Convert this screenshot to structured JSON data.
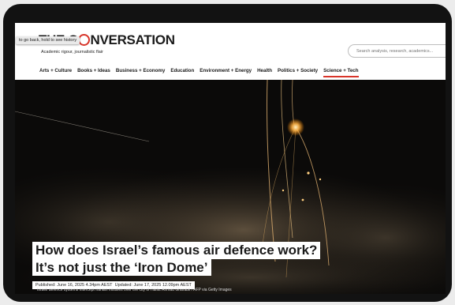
{
  "browser": {
    "back_tooltip": "to go back, hold to see history"
  },
  "site": {
    "logo_prefix": "THE C",
    "logo_suffix": "NVERSATION",
    "tagline": "Academic rigour, journalistic flair"
  },
  "search": {
    "placeholder": "Search analysis, research, academics..."
  },
  "nav": {
    "items": [
      {
        "label": "Arts + Culture"
      },
      {
        "label": "Books + Ideas"
      },
      {
        "label": "Business + Economy"
      },
      {
        "label": "Education"
      },
      {
        "label": "Environment + Energy"
      },
      {
        "label": "Health"
      },
      {
        "label": "Politics + Society"
      },
      {
        "label": "Science + Tech",
        "active": true
      }
    ]
  },
  "article": {
    "headline_line1": "How does Israel’s famous air defence work?",
    "headline_line2": "It’s not just the ‘Iron Dome’",
    "published": "Published: June 16, 2025 4.34pm AEST",
    "updated": "Updated: June 17, 2025 12.09pm AEST",
    "image_caption": "Israeli defence systems intercept Iranian missiles over the city of Haifa. Ahmad Gharabli / AFP via Getty Images"
  },
  "colors": {
    "accent": "#d8352a",
    "device_bezel": "#121212",
    "hero_background": "#0a0a0a"
  }
}
